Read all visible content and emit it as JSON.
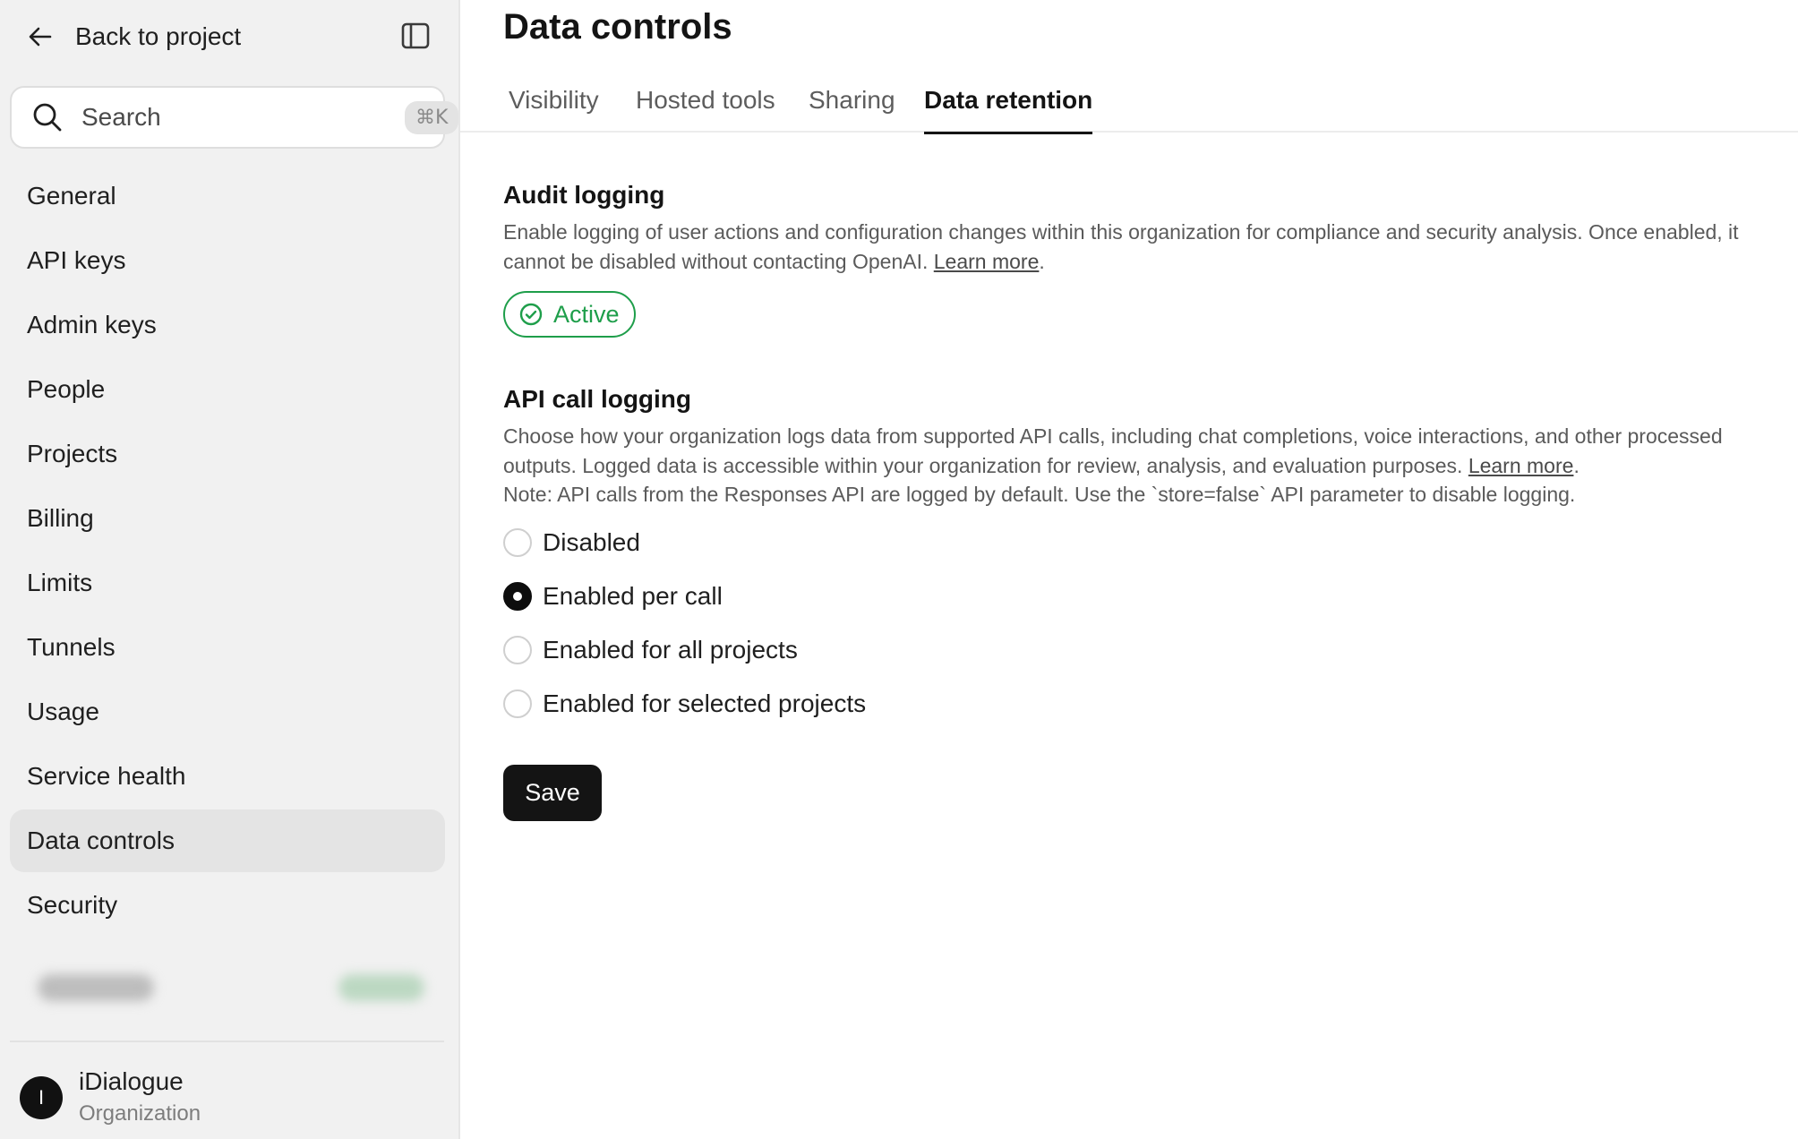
{
  "sidebar": {
    "back_label": "Back to project",
    "collapse_icon": "sidebar-toggle-icon",
    "search": {
      "placeholder": "Search",
      "shortcut": "⌘K"
    },
    "items": [
      {
        "label": "General",
        "active": false
      },
      {
        "label": "API keys",
        "active": false
      },
      {
        "label": "Admin keys",
        "active": false
      },
      {
        "label": "People",
        "active": false
      },
      {
        "label": "Projects",
        "active": false
      },
      {
        "label": "Billing",
        "active": false
      },
      {
        "label": "Limits",
        "active": false
      },
      {
        "label": "Tunnels",
        "active": false
      },
      {
        "label": "Usage",
        "active": false
      },
      {
        "label": "Service health",
        "active": false
      },
      {
        "label": "Data controls",
        "active": true
      },
      {
        "label": "Security",
        "active": false
      }
    ],
    "org": {
      "initial": "I",
      "name": "iDialogue",
      "type": "Organization"
    }
  },
  "main": {
    "title": "Data controls",
    "tabs": [
      {
        "label": "Visibility",
        "active": false
      },
      {
        "label": "Hosted tools",
        "active": false
      },
      {
        "label": "Sharing",
        "active": false
      },
      {
        "label": "Data retention",
        "active": true
      }
    ],
    "audit": {
      "title": "Audit logging",
      "description": "Enable logging of user actions and configuration changes within this organization for compliance and security analysis. Once enabled, it cannot be disabled without contacting OpenAI.",
      "link": "Learn more",
      "status": "Active"
    },
    "api_logging": {
      "title": "API call logging",
      "description_1": "Choose how your organization logs data from supported API calls, including chat completions, voice interactions, and other processed outputs. Logged data is accessible within your organization for review, analysis, and evaluation purposes.",
      "link": "Learn more",
      "description_2": "Note: API calls from the Responses API are logged by default. Use the `store=false` API parameter to disable logging.",
      "options": [
        {
          "label": "Disabled",
          "selected": false
        },
        {
          "label": "Enabled per call",
          "selected": true
        },
        {
          "label": "Enabled for all projects",
          "selected": false
        },
        {
          "label": "Enabled for selected projects",
          "selected": false
        }
      ]
    },
    "save_label": "Save"
  },
  "colors": {
    "sidebar_bg": "#f1f1f1",
    "active_nav_bg": "#e4e4e4",
    "status_green": "#1e9e4a",
    "primary_button": "#141414"
  }
}
